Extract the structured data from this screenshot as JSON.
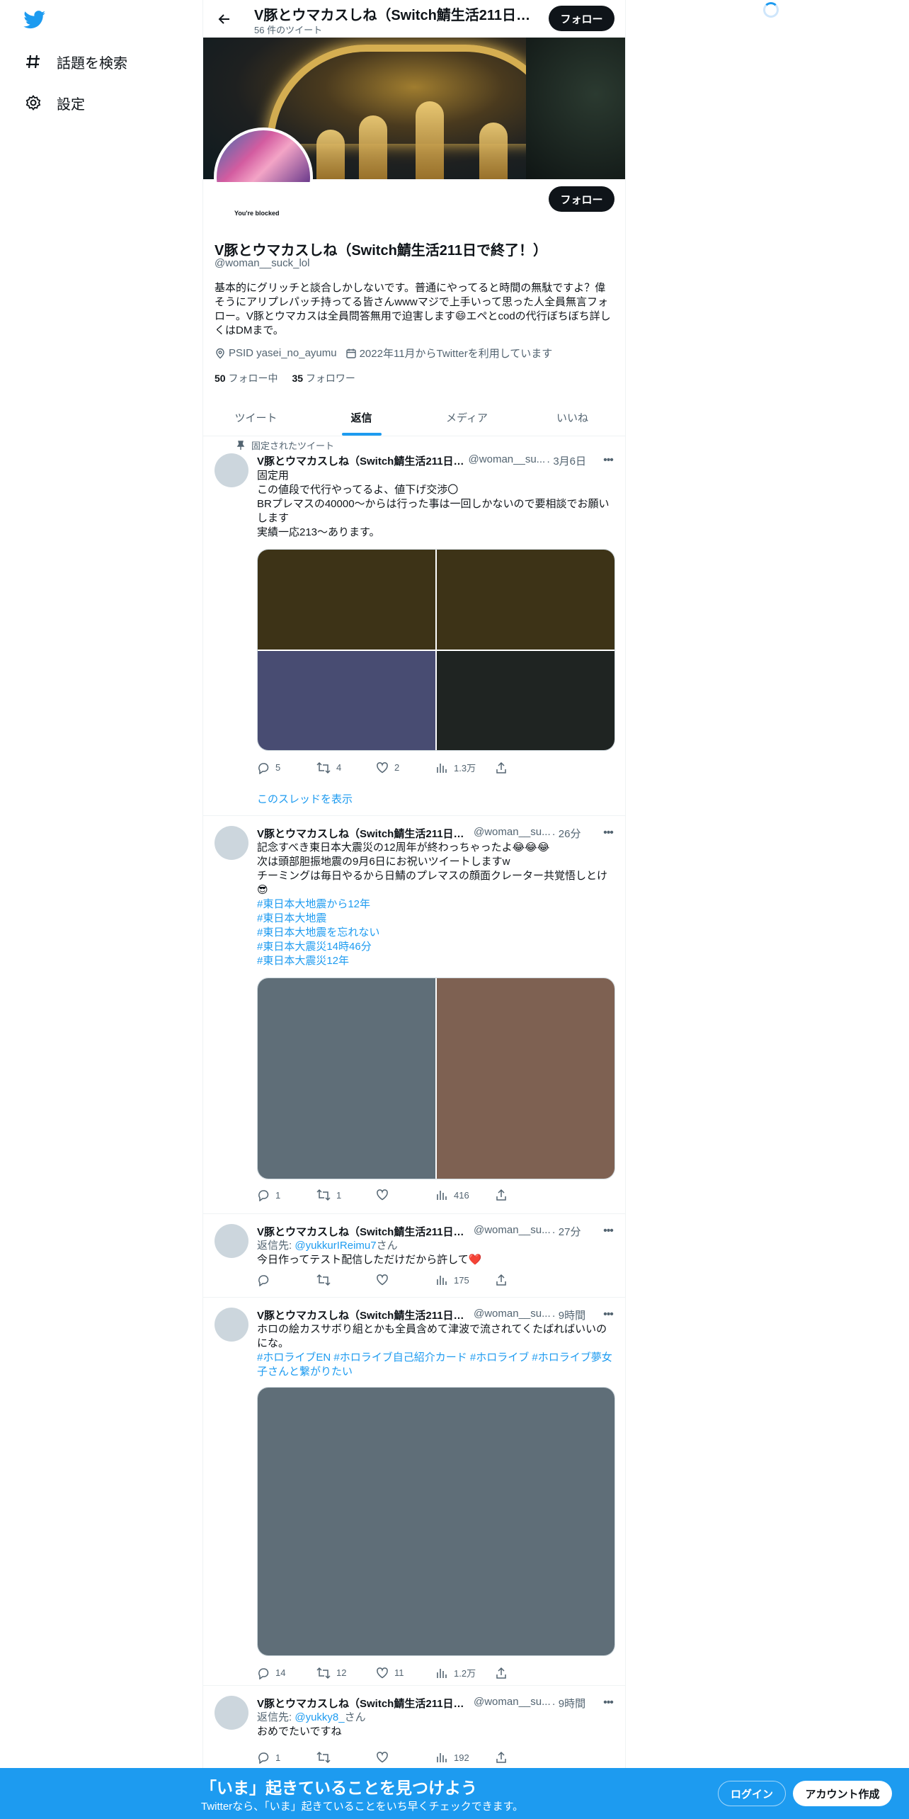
{
  "nav": {
    "explore_label": "話題を検索",
    "settings_label": "設定"
  },
  "header": {
    "title": "V豚とウマカスしね（Switch鯖生活211日で…",
    "tweet_count": "56 件のツイート",
    "follow_label": "フォロー"
  },
  "profile": {
    "blocked_text": "You're blocked",
    "follow_label": "フォロー",
    "name": "V豚とウマカスしね（Switch鯖生活211日で終了！）",
    "handle": "@woman__suck_lol",
    "bio": "基本的にグリッチと談合しかしないです。普通にやってると時間の無駄ですよ？偉そうにアリプレパッチ持ってる皆さんwwwマジで上手いって思った人全員無言フォロー。V豚とウマカスは全員問答無用で迫害します😄エペとcodの代行ぼちぼち詳しくはDMまで。",
    "location": "PSID yasei_no_ayumu",
    "joined": "2022年11月からTwitterを利用しています",
    "following_count": "50",
    "following_label": "フォロー中",
    "followers_count": "35",
    "followers_label": "フォロワー"
  },
  "tabs": [
    {
      "label": "ツイート"
    },
    {
      "label": "返信"
    },
    {
      "label": "メディア"
    },
    {
      "label": "いいね"
    }
  ],
  "pinned_label": "固定されたツイート",
  "tweets": [
    {
      "name": "V豚とウマカスしね（Switch鯖生活211日…",
      "handle": "@woman__su...",
      "time": "· 3月6日",
      "lines": [
        "固定用",
        "この値段で代行やってるよ、値下げ交渉〇",
        "BRプレマスの40000〜からは行った事は一回しかないので要相談でお願いします",
        "実績一応213〜あります。"
      ],
      "media_colors": [
        "#3d3317",
        "#3d3317",
        "#484c72",
        "#1f2422"
      ],
      "replies": "5",
      "retweets": "4",
      "likes": "2",
      "views": "1.3万",
      "thread_label": "このスレッドを表示"
    },
    {
      "name": "V豚とウマカスしね（Switch鯖生活211日で…",
      "handle": "@woman__su...",
      "time": "· 26分",
      "lines": [
        "記念すべき東日本大震災の12周年が終わっちゃったよ😂😂😂",
        "次は頭部胆振地震の9月6日にお祝いツイートしますw",
        "チーミングは毎日やるから日鯖のプレマスの顔面クレーター共覚悟しとけ😎"
      ],
      "tags": [
        "#東日本大地震から12年",
        "#東日本大地震",
        "#東日本大地震を忘れない",
        "#東日本大震災14時46分",
        "#東日本大震災12年"
      ],
      "media_colors": [
        "#5f6e78",
        "#7e6152"
      ],
      "replies": "1",
      "retweets": "1",
      "likes": "",
      "views": "416"
    },
    {
      "name": "V豚とウマカスしね（Switch鯖生活211日で…",
      "handle": "@woman__su...",
      "time": "· 27分",
      "reply_prefix": "返信先:",
      "reply_to": "@yukkurIReimu7",
      "reply_suffix": "さん",
      "lines": [
        "今日作ってテスト配信しただけだから許して❤️"
      ],
      "replies": "",
      "retweets": "",
      "likes": "",
      "views": "175"
    },
    {
      "name": "V豚とウマカスしね（Switch鯖生活211日で…",
      "handle": "@woman__su...",
      "time": "· 9時間",
      "lines": [
        "ホロの絵カスサボり組とかも全員含めて津波で流されてくたばればいいのにな。"
      ],
      "tags_inline": "#ホロライブEN #ホロライブ自己紹介カード #ホロライブ #ホロライブ夢女子さんと繋がりたい",
      "media_colors": [
        "#5f6e78"
      ],
      "replies": "14",
      "retweets": "12",
      "likes": "11",
      "views": "1.2万"
    },
    {
      "name": "V豚とウマカスしね（Switch鯖生活211日で…",
      "handle": "@woman__su...",
      "time": "· 9時間",
      "reply_prefix": "返信先:",
      "reply_to": "@yukky8_",
      "reply_suffix": "さん",
      "lines": [
        "おめでたいですね"
      ],
      "replies": "1",
      "retweets": "",
      "likes": "",
      "views": "192"
    }
  ],
  "bottombar": {
    "title": "「いま」起きていることを見つけよう",
    "subtitle": "Twitterなら、「いま」起きていることをいち早くチェックできます。",
    "login_label": "ログイン",
    "signup_label": "アカウント作成"
  }
}
